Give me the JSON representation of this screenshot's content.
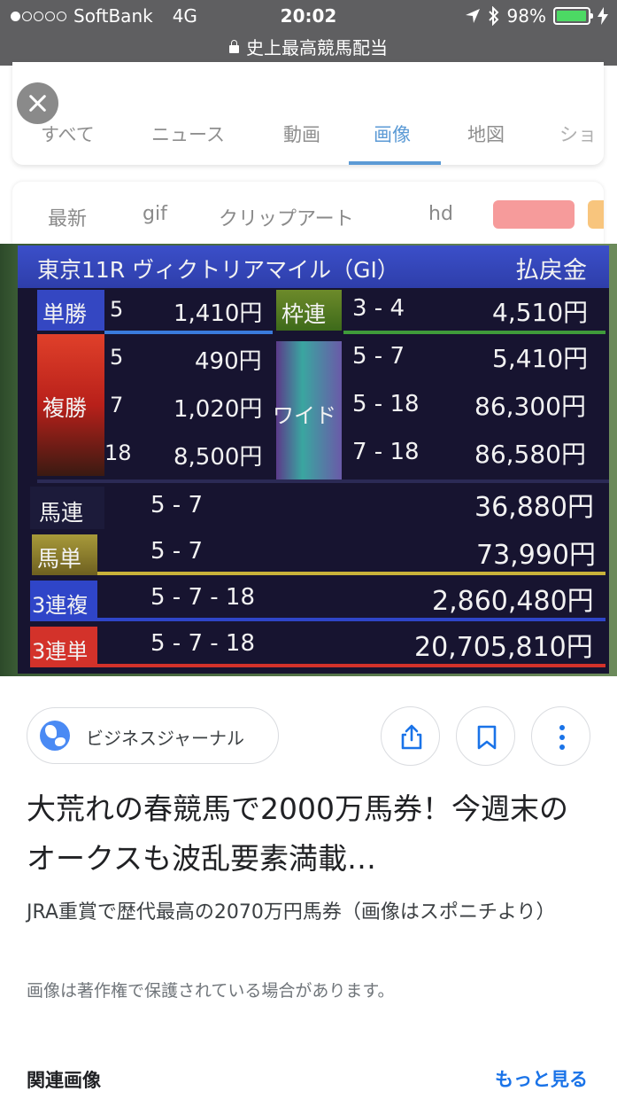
{
  "status_bar": {
    "carrier": "SoftBank",
    "network": "4G",
    "time": "20:02",
    "battery": "98%",
    "battery_level": 0.98,
    "url": "史上最高競馬配当",
    "battery_color": "#4cd964"
  },
  "tabs": [
    {
      "label": "すべて",
      "active": false
    },
    {
      "label": "ニュース",
      "active": false
    },
    {
      "label": "動画",
      "active": false
    },
    {
      "label": "画像",
      "active": true
    },
    {
      "label": "地図",
      "active": false
    },
    {
      "label": "ショ",
      "active": false
    }
  ],
  "filters": {
    "chips": [
      "最新",
      "gif",
      "クリップアート",
      "hd"
    ],
    "color_swatches": [
      "#f69b9b",
      "#f8c57d"
    ]
  },
  "image": {
    "board_title_left": "東京11R ヴィクトリアマイル（GI）",
    "board_title_right": "払戻金",
    "tansho_label": "単勝",
    "tansho_num": "5",
    "tansho_pay": "1,410円",
    "wakuren_label": "枠連",
    "wakuren_combo": "3 - 4",
    "wakuren_pay": "4,510円",
    "fukusho_label": "複勝",
    "fukusho": [
      {
        "num": "5",
        "pay": "490円"
      },
      {
        "num": "7",
        "pay": "1,020円"
      },
      {
        "num": "18",
        "pay": "8,500円"
      }
    ],
    "wide_label": "ワイド",
    "wide": [
      {
        "combo": "5 - 7",
        "pay": "5,410円"
      },
      {
        "combo": "5 - 18",
        "pay": "86,300円"
      },
      {
        "combo": "7 - 18",
        "pay": "86,580円"
      }
    ],
    "lower_rows": [
      {
        "label": "馬連",
        "combo": "5 - 7",
        "pay": "36,880円"
      },
      {
        "label": "馬単",
        "combo": "5 - 7",
        "pay": "73,990円"
      },
      {
        "label": "3連複",
        "combo": "5 - 7 - 18",
        "pay": "2,860,480円"
      },
      {
        "label": "3連単",
        "combo": "5 - 7 - 18",
        "pay": "20,705,810円"
      }
    ]
  },
  "result": {
    "source_name": "ビジネスジャーナル",
    "title": "大荒れの春競馬で2000万馬券！今週末のオークスも波乱要素満載…",
    "description": "JRA重賞で歴代最高の2070万円馬券（画像はスポニチより）",
    "copyright_notice": "画像は著作権で保護されている場合があります。"
  },
  "related": {
    "label": "関連画像",
    "more_label": "もっと見る"
  },
  "colors": {
    "accent": "#5b9ad5",
    "link": "#1a73e8",
    "status_bar": "#5f5f61"
  }
}
